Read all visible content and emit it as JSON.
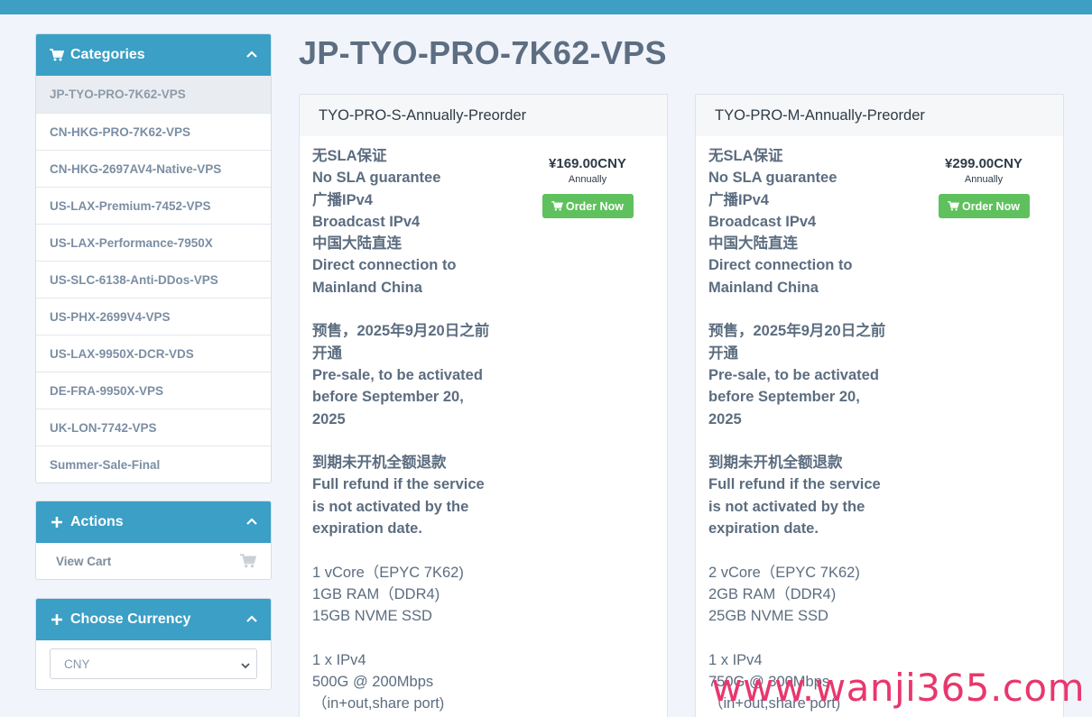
{
  "sidebar": {
    "categories": {
      "title": "Categories",
      "items": [
        "JP-TYO-PRO-7K62-VPS",
        "CN-HKG-PRO-7K62-VPS",
        "CN-HKG-2697AV4-Native-VPS",
        "US-LAX-Premium-7452-VPS",
        "US-LAX-Performance-7950X",
        "US-SLC-6138-Anti-DDos-VPS",
        "US-PHX-2699V4-VPS",
        "US-LAX-9950X-DCR-VDS",
        "DE-FRA-9950X-VPS",
        "UK-LON-7742-VPS",
        "Summer-Sale-Final"
      ]
    },
    "actions": {
      "title": "Actions",
      "view_cart": "View Cart"
    },
    "currency": {
      "title": "Choose Currency",
      "selected": "CNY"
    }
  },
  "page": {
    "title": "JP-TYO-PRO-7K62-VPS"
  },
  "products": [
    {
      "name": "TYO-PRO-S-Annually-Preorder",
      "price": "¥169.00CNY",
      "cycle": "Annually",
      "order_label": "Order Now",
      "lines_bold": [
        "无SLA保证",
        "No SLA guarantee",
        "广播IPv4",
        "Broadcast IPv4",
        "中国大陆直连",
        "Direct connection to",
        "Mainland China"
      ],
      "presale": [
        "预售，2025年9月20日之前",
        "开通",
        "Pre-sale, to be activated",
        "before September 20,",
        "2025"
      ],
      "refund": [
        "到期未开机全额退款",
        "Full refund if the service",
        "is not activated by the",
        "expiration date."
      ],
      "specs": [
        "1 vCore（EPYC 7K62)",
        "1GB RAM（DDR4)",
        "15GB NVME SSD"
      ],
      "network": [
        "1 x IPv4",
        "500G @ 200Mbps",
        "（in+out,share port)"
      ]
    },
    {
      "name": "TYO-PRO-M-Annually-Preorder",
      "price": "¥299.00CNY",
      "cycle": "Annually",
      "order_label": "Order Now",
      "lines_bold": [
        "无SLA保证",
        "No SLA guarantee",
        "广播IPv4",
        "Broadcast IPv4",
        "中国大陆直连",
        "Direct connection to",
        "Mainland China"
      ],
      "presale": [
        "预售，2025年9月20日之前",
        "开通",
        "Pre-sale, to be activated",
        "before September 20,",
        "2025"
      ],
      "refund": [
        "到期未开机全额退款",
        "Full refund if the service",
        "is not activated by the",
        "expiration date."
      ],
      "specs": [
        "2 vCore（EPYC 7K62)",
        "2GB RAM（DDR4)",
        "25GB NVME SSD"
      ],
      "network": [
        "1 x IPv4",
        "750G @ 300Mbps",
        "（in+out,share port)"
      ]
    }
  ],
  "watermark": "www.wanji365.com",
  "colors": {
    "header_blue": "#3b9fc6",
    "order_green": "#5fc15d"
  }
}
